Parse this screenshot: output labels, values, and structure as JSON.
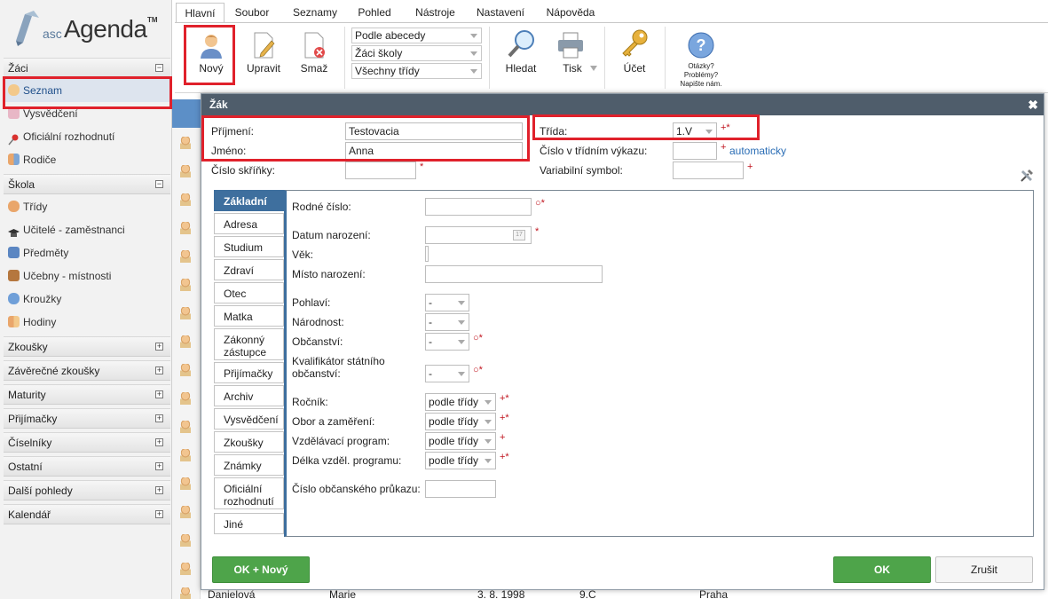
{
  "app": {
    "brand_prefix": "asc",
    "brand_name": "Agenda",
    "brand_tm": "TM"
  },
  "sidebar": {
    "sections": [
      {
        "label": "Žáci",
        "toggle": "−"
      },
      {
        "label": "Škola",
        "toggle": "−"
      },
      {
        "label": "Zkoušky",
        "toggle": "+"
      },
      {
        "label": "Závěrečné zkoušky",
        "toggle": "+"
      },
      {
        "label": "Maturity",
        "toggle": "+"
      },
      {
        "label": "Přijímačky",
        "toggle": "+"
      },
      {
        "label": "Číselníky",
        "toggle": "+"
      },
      {
        "label": "Ostatní",
        "toggle": "+"
      },
      {
        "label": "Další pohledy",
        "toggle": "+"
      },
      {
        "label": "Kalendář",
        "toggle": "+"
      }
    ],
    "zaci_items": [
      {
        "label": "Seznam",
        "icon": "student-icon"
      },
      {
        "label": "Vysvědčení",
        "icon": "certificate-icon"
      },
      {
        "label": "Oficiální rozhodnutí",
        "icon": "pin-icon"
      },
      {
        "label": "Rodiče",
        "icon": "parents-icon"
      }
    ],
    "skola_items": [
      {
        "label": "Třídy",
        "icon": "class-icon"
      },
      {
        "label": "Učitelé - zaměstnanci",
        "icon": "graduation-cap-icon"
      },
      {
        "label": "Předměty",
        "icon": "book-icon"
      },
      {
        "label": "Učebny - místnosti",
        "icon": "door-icon"
      },
      {
        "label": "Kroužky",
        "icon": "puzzle-icon"
      },
      {
        "label": "Hodiny",
        "icon": "people-icon"
      }
    ]
  },
  "ribbon": {
    "tabs": [
      "Hlavní",
      "Soubor",
      "Seznamy",
      "Pohled",
      "Nástroje",
      "Nastavení",
      "Nápověda"
    ],
    "buttons": {
      "new": "Nový",
      "edit": "Upravit",
      "delete": "Smaž",
      "search": "Hledat",
      "print": "Tisk",
      "account": "Účet"
    },
    "selects": [
      "Podle abecedy",
      "Žáci školy",
      "Všechny třídy"
    ],
    "help": {
      "line1": "Otázky?",
      "line2": "Problémy?",
      "line3": "Napište nám."
    }
  },
  "background_row": {
    "surname": "Danielová",
    "name": "Marie",
    "date": "3. 8. 1998",
    "class": "9.C",
    "city": "Praha"
  },
  "modal": {
    "title": "Žák",
    "close": "✖",
    "fields": {
      "prijmeni_label": "Příjmení:",
      "prijmeni_value": "Testovacia",
      "jmeno_label": "Jméno:",
      "jmeno_value": "Anna",
      "skrinka_label": "Číslo skříňky:",
      "trida_label": "Třída:",
      "trida_value": "1.V",
      "cislo_vykaz_label": "Číslo v třídním výkazu:",
      "cislo_vykaz_link": "automaticky",
      "var_symbol_label": "Variabilní symbol:"
    },
    "tabs": [
      "Základní",
      "Adresa",
      "Studium",
      "Zdraví",
      "Otec",
      "Matka",
      "Zákonný zástupce",
      "Přijímačky",
      "Archiv",
      "Vysvědčení",
      "Zkoušky",
      "Známky",
      "Oficiální rozhodnutí",
      "Jiné"
    ],
    "panel": {
      "rodne_cislo": "Rodné číslo:",
      "datum_narozeni": "Datum narození:",
      "vek": "Věk:",
      "misto_narozeni": "Místo narození:",
      "pohlavi": "Pohlaví:",
      "narodnost": "Národnost:",
      "obcanstvi": "Občanství:",
      "kvalifikator_1": "Kvalifikátor státního",
      "kvalifikator_2": "občanství:",
      "rocnik": "Ročník:",
      "obor": "Obor a zaměření:",
      "vzdel_program": "Vzdělávací program:",
      "delka": "Délka vzděl. programu:",
      "obcansky": "Číslo občanského průkazu:",
      "dash": "-",
      "podle_tridy": "podle třídy",
      "calendar_day": "17"
    },
    "buttons": {
      "ok_new": "OK + Nový",
      "ok": "OK",
      "cancel": "Zrušit"
    }
  }
}
